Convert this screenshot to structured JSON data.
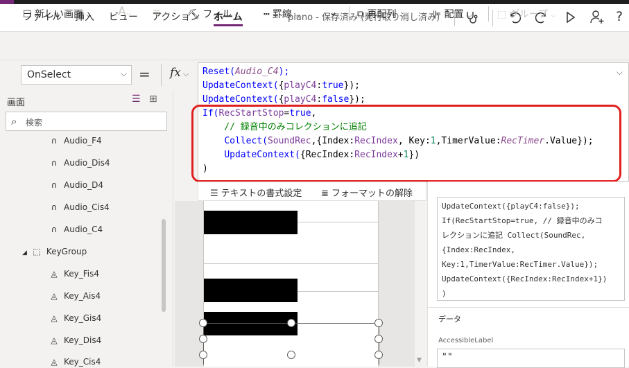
{
  "menu": {
    "items": [
      "ファイル",
      "挿入",
      "ビュー",
      "アクション",
      "ホーム"
    ],
    "active": "ホーム",
    "doc_info": "piano - 保存済み (発行取り消し済み)"
  },
  "toolbar": {
    "new_screen": "新しい画面",
    "fill": "フィル",
    "border": "罫線",
    "reorder": "再配列",
    "align": "配置",
    "group": "グループ"
  },
  "formula": {
    "property": "OnSelect",
    "equals": "=",
    "fx": "fx"
  },
  "code_lines": [
    "Reset(Audio_C4);",
    "UpdateContext({playC4:true});",
    "UpdateContext({playC4:false});",
    "If(RecStartStop=true,",
    "    // 録音中のみコレクションに追記",
    "    Collect(SoundRec,{Index:RecIndex, Key:1,TimerValue:RecTimer.Value});",
    "    UpdateContext({RecIndex:RecIndex+1})",
    ")"
  ],
  "format_bar": {
    "format_text": "テキストの書式設定",
    "remove_format": "フォーマットの解除"
  },
  "left_pane": {
    "title": "画面",
    "search_placeholder": "検索",
    "items": [
      {
        "label": "Audio_F4",
        "icon": "headphones-icon"
      },
      {
        "label": "Audio_Dis4",
        "icon": "headphones-icon"
      },
      {
        "label": "Audio_D4",
        "icon": "headphones-icon"
      },
      {
        "label": "Audio_Cis4",
        "icon": "headphones-icon"
      },
      {
        "label": "Audio_C4",
        "icon": "headphones-icon"
      },
      {
        "label": "KeyGroup",
        "icon": "group-icon"
      },
      {
        "label": "Key_Fis4",
        "icon": "shape-icon"
      },
      {
        "label": "Key_Ais4",
        "icon": "shape-icon"
      },
      {
        "label": "Key_Gis4",
        "icon": "shape-icon"
      },
      {
        "label": "Key_Dis4",
        "icon": "shape-icon"
      },
      {
        "label": "Key_Cis4",
        "icon": "shape-icon"
      }
    ]
  },
  "right_pane": {
    "preview_lines": [
      "UpdateContext({playC4:false});",
      "If(RecStartStop=true, // 録音中のみコ",
      "レクションに追記 Collect(SoundRec,",
      "{Index:RecIndex,",
      "Key:1,TimerValue:RecTimer.Value});",
      "UpdateContext({RecIndex:RecIndex+1})",
      ")"
    ],
    "section_data": "データ",
    "accessible_label": "AccessibleLabel",
    "accessible_value": "\"\""
  },
  "colors": {
    "brand": "#742774",
    "highlight_box": "#e0201f"
  }
}
